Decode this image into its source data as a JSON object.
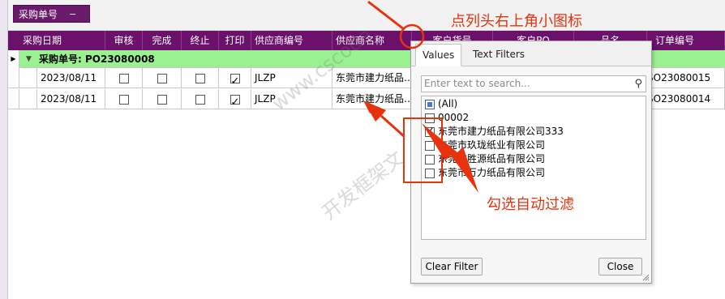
{
  "group_panel": {
    "chip_label": "采购单号",
    "chip_remove": "−"
  },
  "columns": [
    "采购日期",
    "审核",
    "完成",
    "终止",
    "打印",
    "供应商编号",
    "供应商名称",
    "客户货号",
    "客户PO",
    "品名",
    "订单编号"
  ],
  "group_row": {
    "text": "采购单号: PO23080008"
  },
  "rows": [
    {
      "date": "2023/08/11",
      "audit": false,
      "done": false,
      "stop": false,
      "print": true,
      "supplier_code": "JLZP",
      "supplier_name": "东莞市建力纸品…",
      "order_no": "SO23080015"
    },
    {
      "date": "2023/08/11",
      "audit": false,
      "done": false,
      "stop": false,
      "print": true,
      "supplier_code": "JLZP",
      "supplier_name": "东莞市建力纸品…",
      "order_no": "SO23080014"
    }
  ],
  "filter_popup": {
    "tabs": [
      "Values",
      "Text Filters"
    ],
    "active_tab": "Values",
    "search_placeholder": "Enter text to search...",
    "items": [
      {
        "label": "(All)",
        "state": "indeterminate"
      },
      {
        "label": "00002",
        "state": "unchecked"
      },
      {
        "label": "东莞市建力纸品有限公司333",
        "state": "checked"
      },
      {
        "label": "东莞市玖珑纸业有限公司",
        "state": "unchecked"
      },
      {
        "label": "东莞市胜源纸品有限公司",
        "state": "unchecked"
      },
      {
        "label": "东莞市万力纸品有限公司",
        "state": "unchecked"
      }
    ],
    "clear_button": "Clear Filter",
    "close_button": "Close"
  },
  "annotations": {
    "top": "点列头右上角小图标",
    "bottom": "勾选自动过滤",
    "color": "#e8320d"
  },
  "watermark": {
    "line1": "www.cscode",
    "line2": "开发框架文"
  }
}
